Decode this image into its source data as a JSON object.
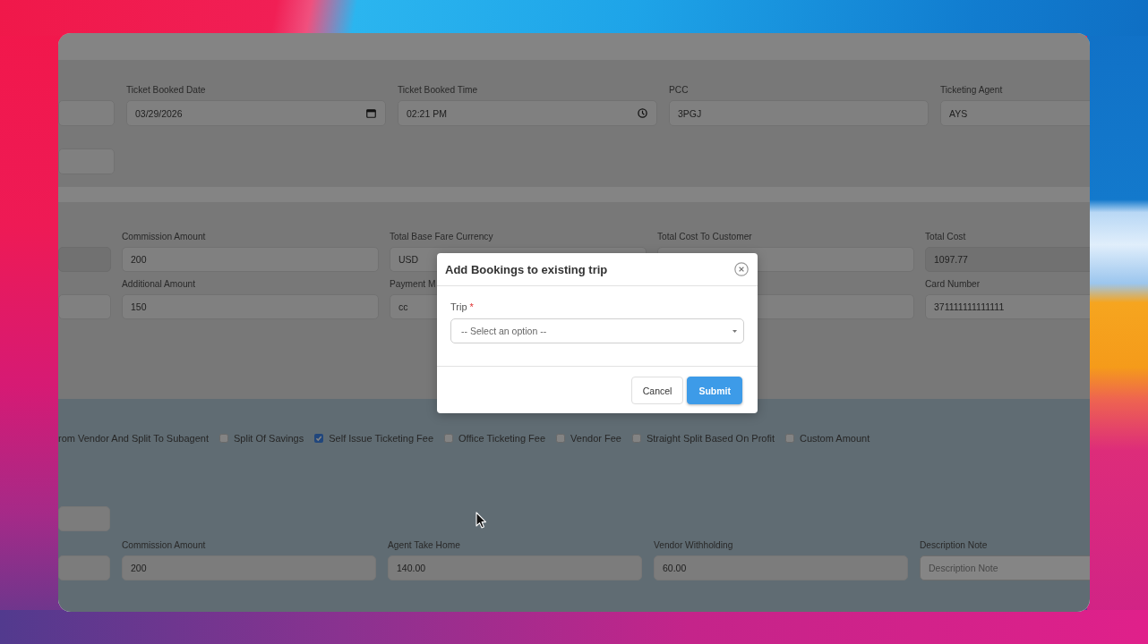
{
  "window": {
    "sections": [
      {
        "kind": "card",
        "rows": [
          [
            {
              "kind": "text"
            },
            {
              "kind": "date",
              "label": "Ticket Booked Date",
              "value": "03/29/2026"
            },
            {
              "kind": "time",
              "label": "Ticket Booked Time",
              "value": "02:21 PM"
            },
            {
              "kind": "text",
              "label": "PCC",
              "value": "3PGJ"
            },
            {
              "kind": "text",
              "label": "Ticketing Agent",
              "value": "AYS"
            }
          ],
          [
            {
              "kind": "text"
            }
          ]
        ]
      },
      {
        "kind": "card",
        "rows": [
          [
            {
              "kind": "readonly"
            },
            {
              "kind": "text",
              "label": "Commission Amount",
              "value": "200"
            },
            {
              "kind": "text",
              "label": "Total Base Fare Currency",
              "value": "USD"
            },
            {
              "kind": "text",
              "label": "Total Cost To Customer"
            },
            {
              "kind": "readonly",
              "label": "Total Cost",
              "value": "1097.77"
            }
          ],
          [
            {
              "kind": "text"
            },
            {
              "kind": "text",
              "label": "Additional Amount",
              "value": "150"
            },
            {
              "kind": "text",
              "label": "Payment M",
              "value": "cc"
            },
            {
              "kind": "text"
            },
            {
              "kind": "text",
              "label": "Card Number",
              "value": "371111111111111"
            }
          ]
        ]
      },
      {
        "kind": "panel",
        "options": [
          {
            "label": "rom Vendor And Split To Subagent"
          },
          {
            "label": "Split Of Savings",
            "checked": false
          },
          {
            "label": "Self Issue Ticketing Fee",
            "checked": true
          },
          {
            "label": "Office Ticketing Fee",
            "checked": false
          },
          {
            "label": "Vendor Fee",
            "checked": false
          },
          {
            "label": "Straight Split Based On Profit",
            "checked": false
          },
          {
            "label": "Custom Amount",
            "checked": false
          }
        ],
        "rows": [
          [
            {
              "kind": "disabled"
            }
          ],
          [
            {
              "kind": "disabled"
            },
            {
              "kind": "disabled",
              "label": "Commission Amount",
              "value": "200"
            },
            {
              "kind": "disabled",
              "label": "Agent Take Home",
              "value": "140.00"
            },
            {
              "kind": "disabled",
              "label": "Vendor Withholding",
              "value": "60.00"
            },
            {
              "kind": "text",
              "label": "Description Note",
              "placeholder": "Description Note"
            }
          ]
        ]
      }
    ]
  },
  "modal": {
    "title": "Add Bookings to existing trip",
    "fields": [
      {
        "label": "Trip",
        "required_mark": "*",
        "placeholder": "-- Select an option --"
      }
    ],
    "buttons": [
      {
        "label": "Cancel",
        "kind": "secondary"
      },
      {
        "label": "Submit",
        "kind": "primary"
      }
    ]
  }
}
